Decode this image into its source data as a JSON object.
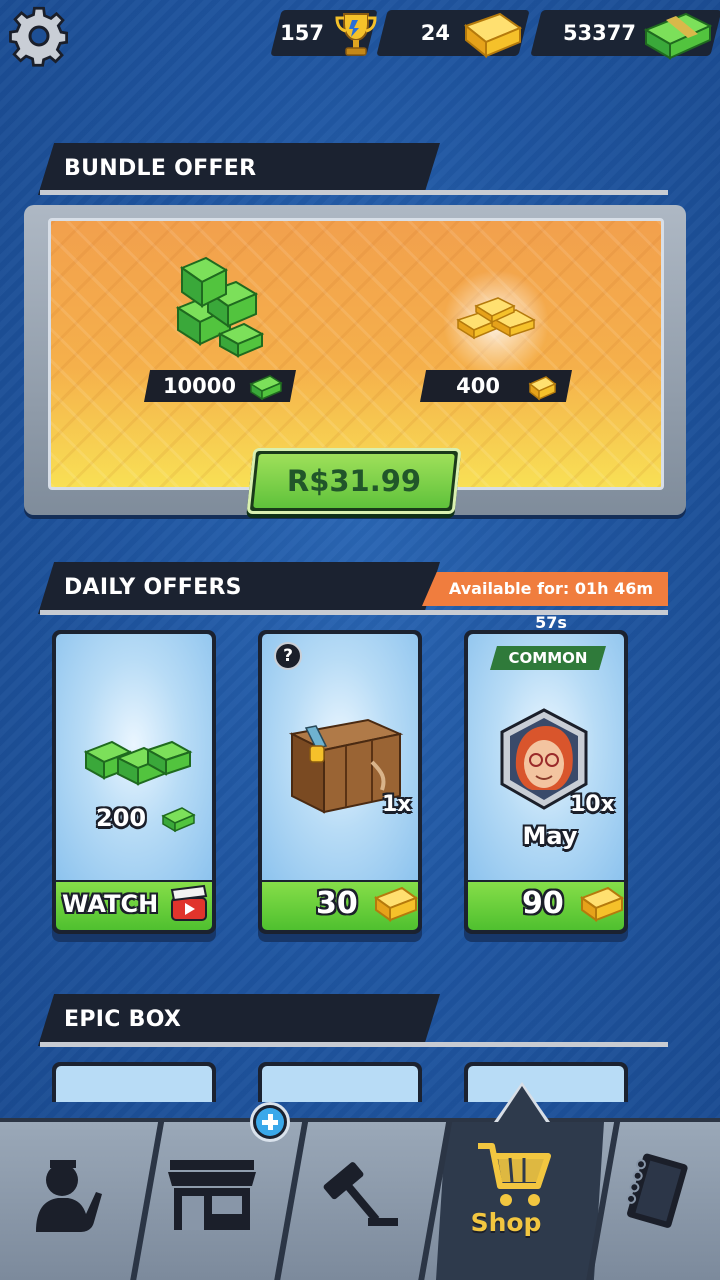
{
  "topbar": {
    "trophies": "157",
    "gold": "24",
    "cash": "53377"
  },
  "bundle": {
    "title": "BUNDLE OFFER",
    "cash_amount": "10000",
    "gold_amount": "400",
    "price": "R$31.99"
  },
  "daily": {
    "title": "DAILY OFFERS",
    "available": "Available for: 01h 46m 57s",
    "cards": [
      {
        "amount": "200",
        "action": "WATCH"
      },
      {
        "qty": "1x",
        "price": "30",
        "question": "?"
      },
      {
        "rarity": "COMMON",
        "qty": "10x",
        "name": "May",
        "price": "90"
      }
    ]
  },
  "epic": {
    "title": "EPIC BOX"
  },
  "nav": {
    "items": [
      "characters",
      "store",
      "auction",
      "shop",
      "notebook"
    ],
    "active": "Shop"
  },
  "colors": {
    "background": "#1f55a0",
    "cash_green": "#4fc02f",
    "gold": "#f5c12a",
    "timer_orange": "#f07d3e",
    "rarity_common": "#2f7a3a",
    "shop_label": "#f2c640"
  }
}
